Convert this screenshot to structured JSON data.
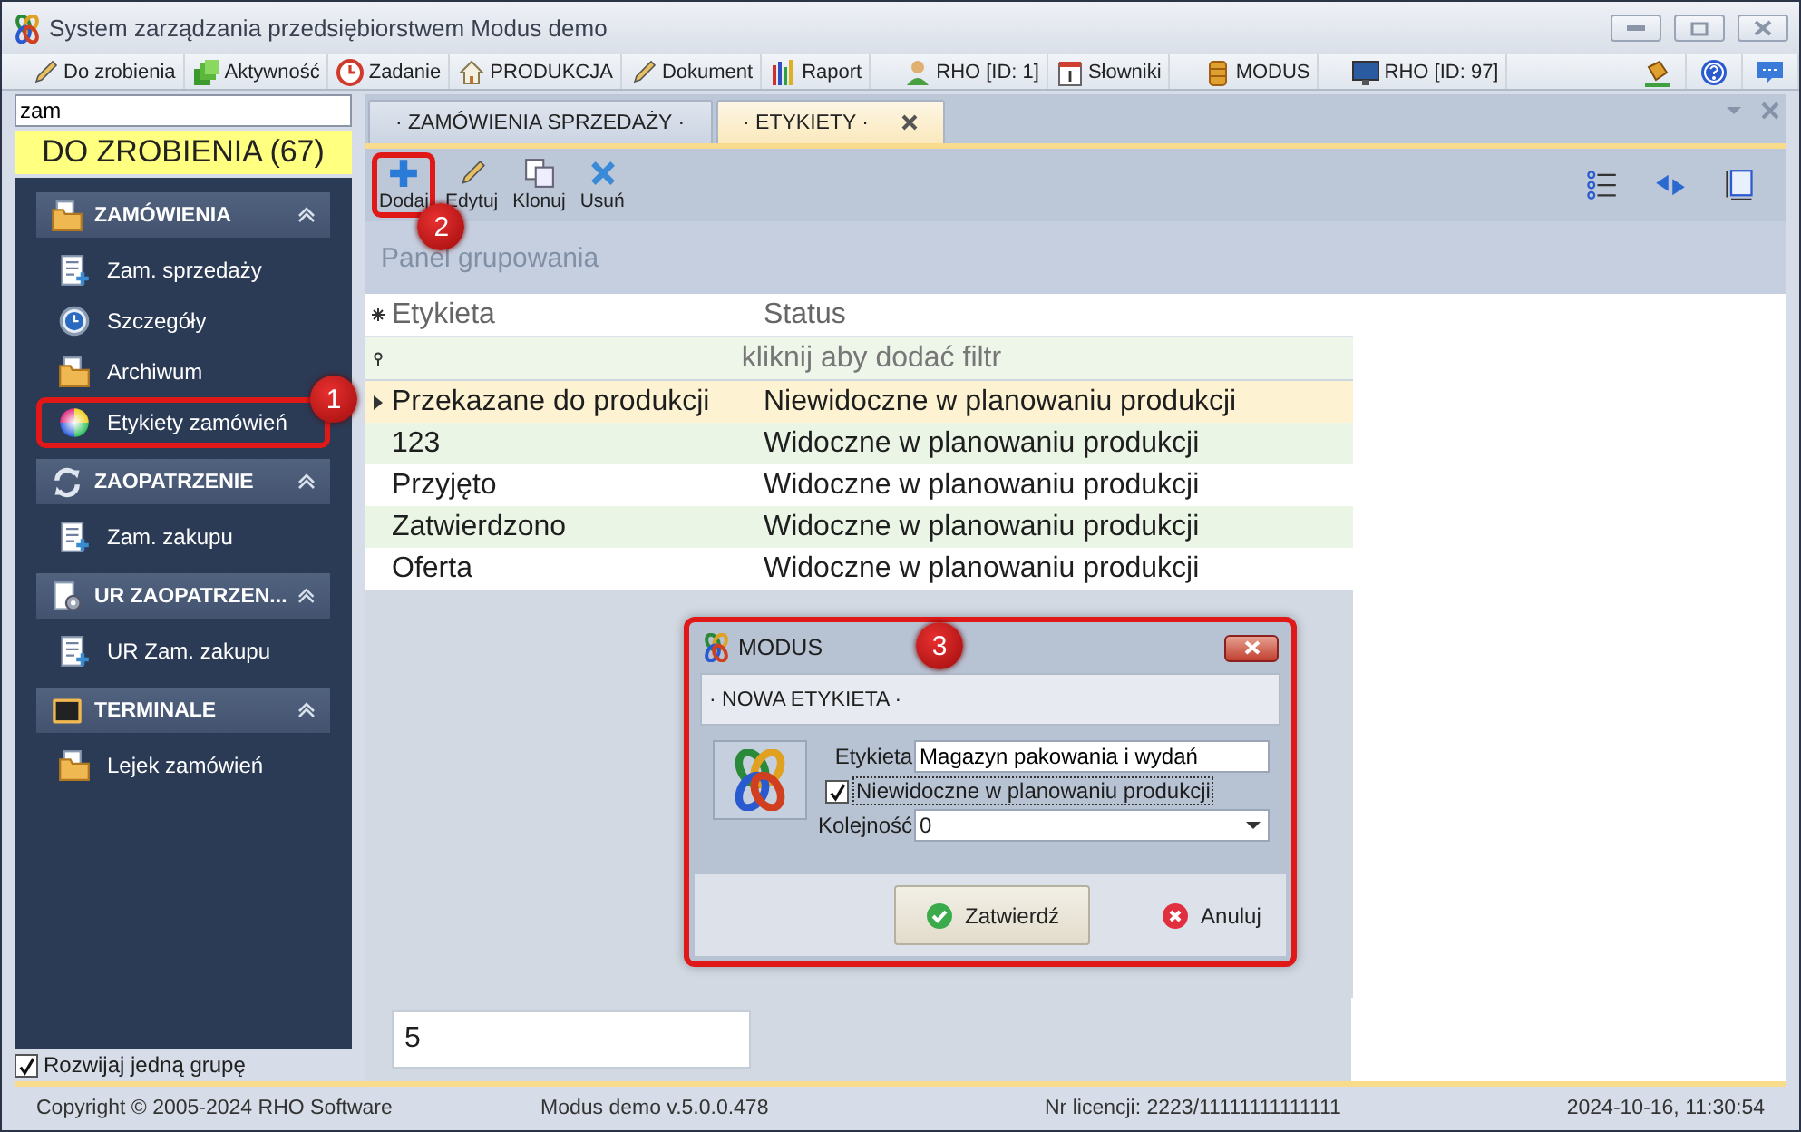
{
  "window": {
    "title": "System zarządzania przedsiębiorstwem Modus demo"
  },
  "menu": [
    {
      "label": "Do zrobienia"
    },
    {
      "label": "Aktywność"
    },
    {
      "label": "Zadanie"
    },
    {
      "label": "PRODUKCJA"
    },
    {
      "label": "Dokument"
    },
    {
      "label": "Raport"
    },
    {
      "label": "RHO [ID: 1]"
    },
    {
      "label": "Słowniki"
    },
    {
      "label": "MODUS"
    },
    {
      "label": "RHO [ID: 97]"
    }
  ],
  "search": {
    "value": "zam"
  },
  "todo_banner": "DO ZROBIENIA (67)",
  "sidebar": {
    "groups": [
      {
        "title": "ZAMÓWIENIA",
        "expanded": true,
        "items": [
          {
            "label": "Zam. sprzedaży"
          },
          {
            "label": "Szczegóły"
          },
          {
            "label": "Archiwum"
          },
          {
            "label": "Etykiety zamówień",
            "callout": "1"
          }
        ]
      },
      {
        "title": "ZAOPATRZENIE",
        "expanded": true,
        "items": [
          {
            "label": "Zam. zakupu"
          }
        ]
      },
      {
        "title": "UR ZAOPATRZEN...",
        "expanded": true,
        "items": [
          {
            "label": "UR Zam. zakupu"
          }
        ]
      },
      {
        "title": "TERMINALE",
        "expanded": true,
        "items": [
          {
            "label": "Lejek zamówień"
          }
        ]
      }
    ]
  },
  "expand_one_group": {
    "label": "Rozwijaj jedną grupę",
    "checked": true
  },
  "tabs": [
    {
      "label": "· ZAMÓWIENIA SPRZEDAŻY ·",
      "selected": false,
      "closable": false
    },
    {
      "label": "· ETYKIETY ·",
      "selected": true,
      "closable": true
    }
  ],
  "toolbar": [
    {
      "label": "Dodaj",
      "callout": "2"
    },
    {
      "label": "Edytuj"
    },
    {
      "label": "Klonuj"
    },
    {
      "label": "Usuń"
    }
  ],
  "group_panel": "Panel grupowania",
  "table": {
    "columns": [
      "Etykieta",
      "Status"
    ],
    "filter_hint": "kliknij aby dodać filtr",
    "rows": [
      {
        "cells": [
          "Przekazane do produkcji",
          "Niewidoczne w planowaniu produkcji"
        ],
        "selected": true
      },
      {
        "cells": [
          "123",
          "Widoczne w planowaniu produkcji"
        ],
        "selected": false
      },
      {
        "cells": [
          "Przyjęto",
          "Widoczne w planowaniu produkcji"
        ],
        "selected": false
      },
      {
        "cells": [
          "Zatwierdzono",
          "Widoczne w planowaniu produkcji"
        ],
        "selected": false
      },
      {
        "cells": [
          "Oferta",
          "Widoczne w planowaniu produkcji"
        ],
        "selected": false
      }
    ]
  },
  "footer_count": "5",
  "dialog": {
    "title": "MODUS",
    "callout": "3",
    "section": "· NOWA ETYKIETA ·",
    "name_field": {
      "label": "Etykieta",
      "value": "Magazyn pakowania i wydań"
    },
    "hidden_checkbox": {
      "label": "Niewidoczne w planowaniu produkcji",
      "checked": true
    },
    "order_field": {
      "label": "Kolejność",
      "value": "0"
    },
    "buttons": [
      {
        "label": "Zatwierdź",
        "kind": "ok"
      },
      {
        "label": "Anuluj",
        "kind": "cancel"
      }
    ]
  },
  "status_bar": [
    "Copyright © 2005-2024 RHO Software",
    "Modus demo v.5.0.0.478",
    "Nr licencji: 2223/11111111111111",
    "2024-10-16,  11:30:54"
  ]
}
